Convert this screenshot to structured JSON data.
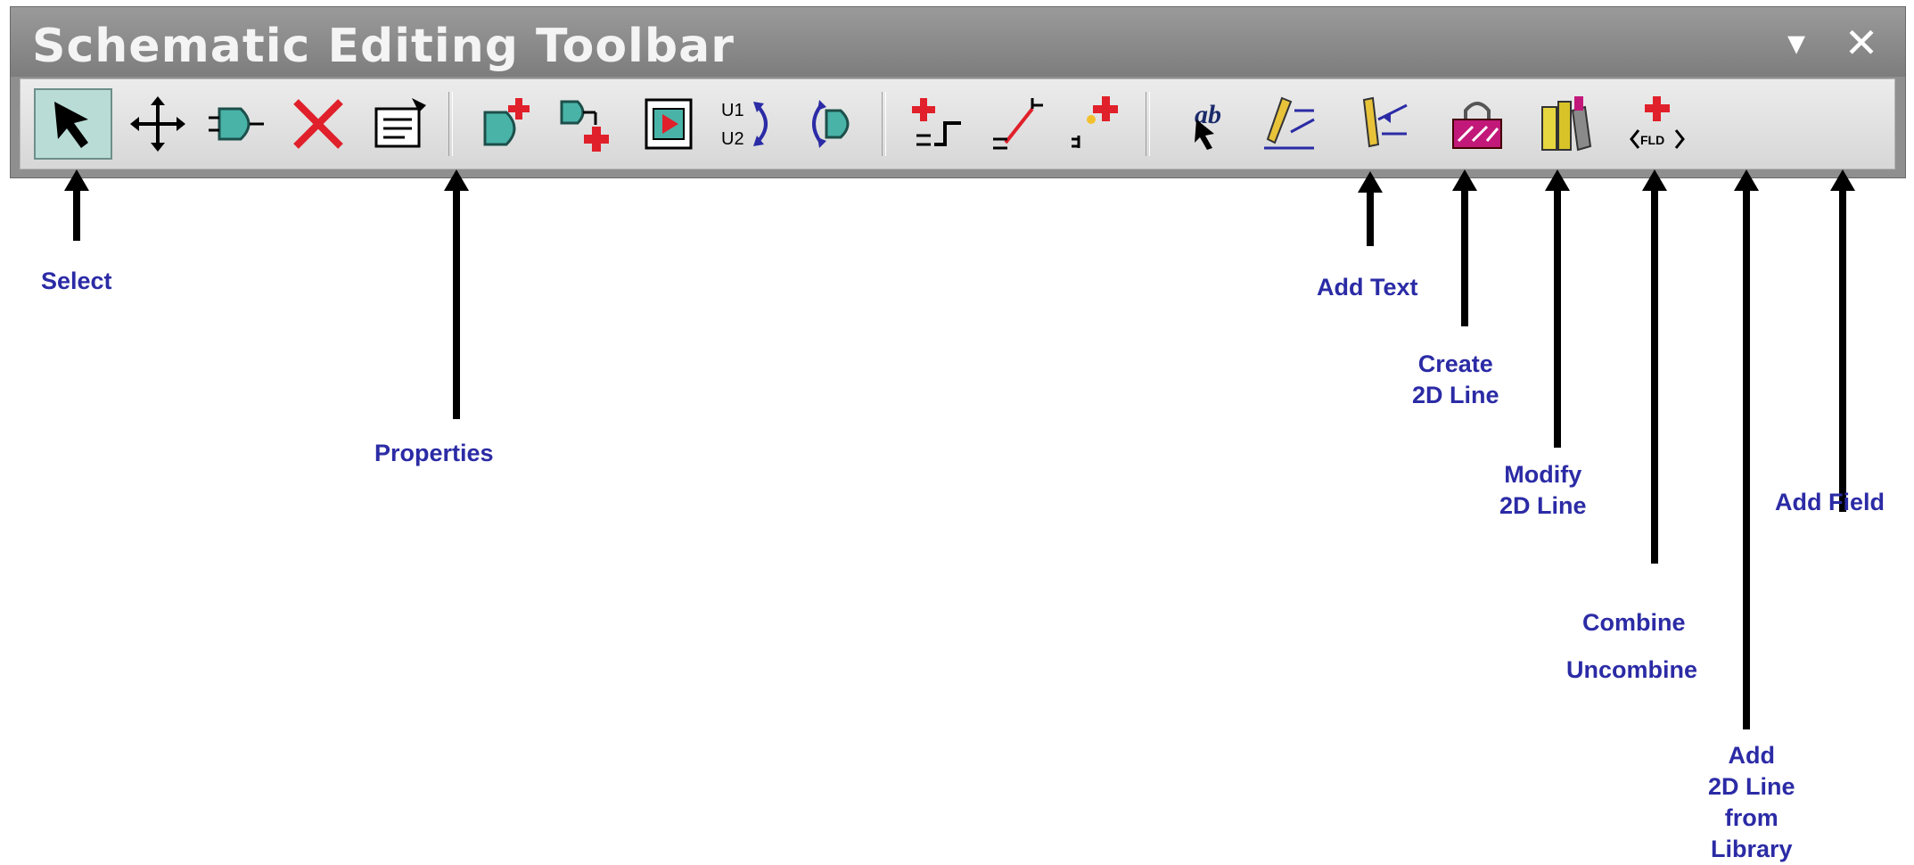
{
  "window": {
    "title": "Schematic Editing Toolbar",
    "dropdown_glyph": "▾",
    "close_glyph": "✕"
  },
  "toolbar_buttons": [
    {
      "id": "select",
      "icon": "select-pointer-icon",
      "active": true
    },
    {
      "id": "move",
      "icon": "move-arrows-icon"
    },
    {
      "id": "component",
      "icon": "component-symbol-icon"
    },
    {
      "id": "delete",
      "icon": "delete-x-icon"
    },
    {
      "id": "properties",
      "icon": "properties-sheet-icon"
    },
    {
      "id": "add-component",
      "icon": "add-component-icon"
    },
    {
      "id": "add-connection",
      "icon": "add-connection-icon"
    },
    {
      "id": "block",
      "icon": "block-icon"
    },
    {
      "id": "swap-refdes",
      "icon": "swap-refdes-icon",
      "text_top": "U1",
      "text_bottom": "U2"
    },
    {
      "id": "swap-gates",
      "icon": "swap-gates-icon"
    },
    {
      "id": "add-wire-1",
      "icon": "add-wire-icon"
    },
    {
      "id": "add-wire-2",
      "icon": "add-wire-diagonal-icon"
    },
    {
      "id": "add-wire-3",
      "icon": "add-wire-pin-icon"
    },
    {
      "id": "add-text",
      "icon": "add-text-icon",
      "text": "ab"
    },
    {
      "id": "create-2d-line",
      "icon": "create-2d-line-icon"
    },
    {
      "id": "modify-2d-line",
      "icon": "modify-2d-line-icon"
    },
    {
      "id": "combine",
      "icon": "combine-lock-icon"
    },
    {
      "id": "add-2d-line-library",
      "icon": "library-books-icon"
    },
    {
      "id": "add-field",
      "icon": "add-field-icon",
      "text": "FLD"
    }
  ],
  "callouts": {
    "select": "Select",
    "properties": "Properties",
    "add_text": "Add Text",
    "create_2d_line": "Create\n2D Line",
    "modify_2d_line": "Modify\n2D Line",
    "combine": "Combine",
    "uncombine": "Uncombine",
    "add_2d_line_library": "Add\n2D Line\nfrom\nLibrary",
    "add_field": "Add Field"
  },
  "colors": {
    "label": "#2b2ba6",
    "titlebar": "#8f8f8f",
    "active_button": "#b9ddd6",
    "red_plus": "#e0202a",
    "teal_gate": "#49b3a8"
  }
}
